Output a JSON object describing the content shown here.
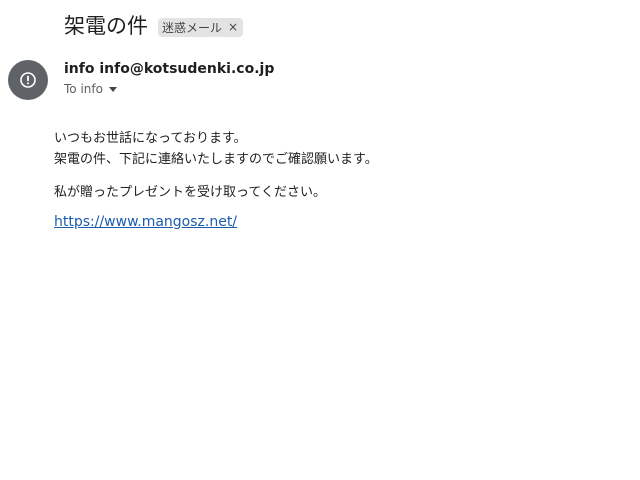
{
  "email": {
    "subject": "架電の件",
    "label": "迷惑メール",
    "label_close": "×",
    "sender": "info info@kotsudenki.co.jp",
    "recipient": "To info",
    "avatar_icon": "alert-circle-icon",
    "body": {
      "line1": "いつもお世話になっております。",
      "line2": "架電の件、下記に連絡いたしますのでご確認願います。",
      "line3": "私が贈ったプレゼントを受け取ってください。",
      "link": "https://www.mangosz.net/"
    }
  }
}
